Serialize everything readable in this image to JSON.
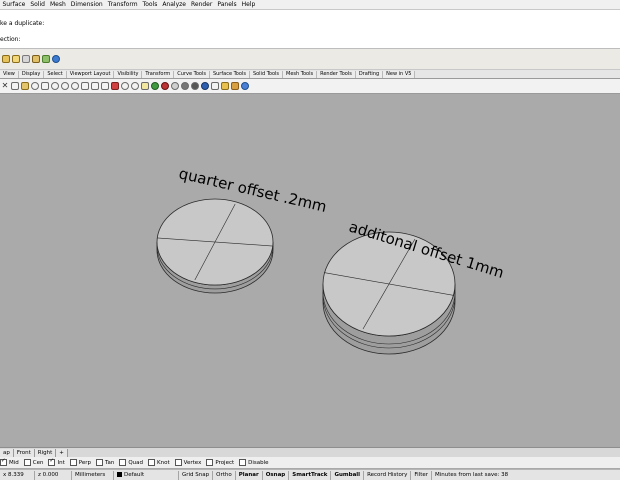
{
  "menu": [
    "Surface",
    "Solid",
    "Mesh",
    "Dimension",
    "Transform",
    "Tools",
    "Analyze",
    "Render",
    "Panels",
    "Help"
  ],
  "command": {
    "history_line": "ke a duplicate:",
    "prompt_line": "ection:"
  },
  "toolbar_tabs": [
    "View",
    "Display",
    "Select",
    "Viewport Layout",
    "Visibility",
    "Transform",
    "Curve Tools",
    "Surface Tools",
    "Solid Tools",
    "Mesh Tools",
    "Render Tools",
    "Drafting",
    "New in V5"
  ],
  "viewport": {
    "annotation_left": "quarter offset .2mm",
    "annotation_right": "additonal offset 1mm"
  },
  "viewport_tabs": [
    "ap",
    "Front",
    "Right",
    "+"
  ],
  "osnaps": [
    {
      "label": "Mid",
      "checked": true
    },
    {
      "label": "Cen",
      "checked": false
    },
    {
      "label": "Int",
      "checked": true
    },
    {
      "label": "Perp",
      "checked": false
    },
    {
      "label": "Tan",
      "checked": false
    },
    {
      "label": "Quad",
      "checked": false
    },
    {
      "label": "Knot",
      "checked": false
    },
    {
      "label": "Vertex",
      "checked": false
    },
    {
      "label": "Project",
      "checked": false
    },
    {
      "label": "Disable",
      "checked": false
    }
  ],
  "status": {
    "x": "x 8.339",
    "z": "z 0.000",
    "units": "Millimeters",
    "layer": "Default",
    "grid_snap": "Grid Snap",
    "ortho": "Ortho",
    "planar": "Planar",
    "osnap": "Osnap",
    "smarttrack": "SmartTrack",
    "gumball": "Gumball",
    "record_history": "Record History",
    "filter": "Filter",
    "autosave": "Minutes from last save: 38"
  },
  "colors": {
    "viewport_bg": "#aaaaaa",
    "disk_fill": "#c8c8c8",
    "edge": "#2a2a2a"
  }
}
